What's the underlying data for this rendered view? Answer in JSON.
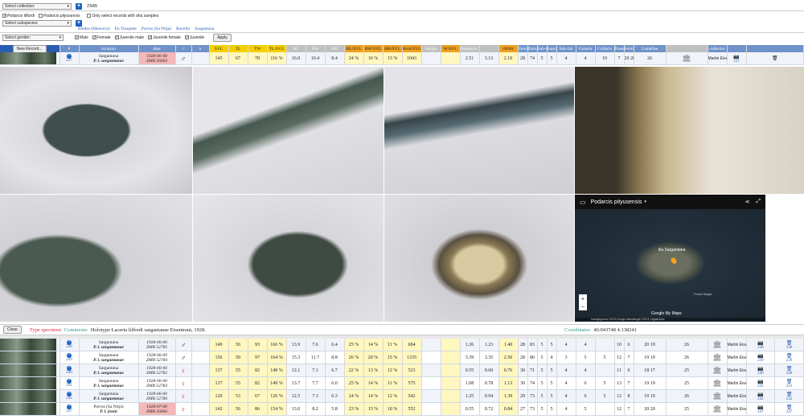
{
  "filters": {
    "collection_placeholder": "Select collection:",
    "collection_code": "ZMB",
    "species": [
      {
        "label": "Podarcis lilfordi",
        "checked": true
      },
      {
        "label": "Podarcis pityusensis",
        "checked": false
      }
    ],
    "dna_label": "Only select records with dna samples",
    "subspecies_placeholder": "Select subspecies:",
    "localities": [
      "Bledes (Menorca)",
      "En Tosqueta",
      "Porros (Sa Nitja)",
      "Ravello",
      "Sargantana"
    ],
    "gender_placeholder": "Select gender:",
    "genders": [
      {
        "label": "Male",
        "checked": true
      },
      {
        "label": "Female",
        "checked": true
      },
      {
        "label": "Juvenile male",
        "checked": true
      },
      {
        "label": "Juvenile female",
        "checked": true
      },
      {
        "label": "Juvenile",
        "checked": true
      }
    ],
    "apply_label": "Apply"
  },
  "table": {
    "new_record_label": "New Record...",
    "headers": [
      "location",
      "date",
      "♂",
      "n",
      "SVL",
      "TL",
      "TW",
      "TL/SVL",
      "HL",
      "HW",
      "HH",
      "HL/SVL",
      "HW/SVL",
      "HH/SVL",
      "Hvol/SVL",
      "Weight",
      "W/SVL",
      "Massetric",
      "",
      "rMAS",
      "Ventralia",
      "Dorsalia",
      "Sub-mac",
      "Supra-lab",
      "Sub-lab",
      "Gularia",
      "Collaria",
      "Praeanalia",
      "Femoralia",
      "Lamellae",
      "",
      "collector"
    ]
  },
  "selected": {
    "id": "237",
    "loc1": "Sargantana",
    "loc2": "P. l. sargantanae",
    "date": "1928-06-00",
    "num": "ZMB 56063",
    "sex": "♂",
    "n": "",
    "svl": "145",
    "tl": "67",
    "tw": "78",
    "tlsvl": "116 %",
    "hl": "16.0",
    "hw": "10.4",
    "hh": "8.4",
    "hlsvl": "24 %",
    "hwsvl": "16 %",
    "hhsvl": "13 %",
    "hvol": "1043",
    "mas1": "2.51",
    "mas2": "3.13",
    "rmas": "2.10",
    "ventr": "28",
    "dors": "74",
    "submac": "5",
    "supra": "5",
    "sublab": "4",
    "gul": "4",
    "coll": "10",
    "prae": "7",
    "fem1": "20",
    "fem2": "20",
    "lam": "26",
    "collector": "Martin Eisentraut",
    "copy": "237"
  },
  "map": {
    "title": "Podarcis pityusensis",
    "place": "illa Sargantana",
    "attribution": "Kaartgegevens ©2019 Google Afbeeldingen ©2019, DigitalGlobe",
    "google": "Google My Maps",
    "label2": "Punta Negra"
  },
  "detail": {
    "close_label": "Close",
    "type_label": "Type specimen",
    "comments_label": "Comments:",
    "comments": "Holotype Lacerta lilfordi sargantanae Eisentraut, 1928.",
    "coords_label": "Coordinates:",
    "coords": "40.043748 4.138241"
  },
  "rows": [
    {
      "id": "238",
      "loc1": "Sargantana",
      "loc2": "P. l. sargantanae",
      "date": "1928-06-00",
      "num": "ZMB 52785",
      "sex": "♂",
      "svl": "149",
      "tl": "56",
      "tw": "93",
      "tlsvl": "166 %",
      "hl": "13.9",
      "hw": "7.6",
      "hh": "6.4",
      "hlsvl": "25 %",
      "hwsvl": "14 %",
      "hhsvl": "11 %",
      "hvol": "604",
      "mas1": "1.26",
      "mas2": "1.23",
      "rmas": "1.40",
      "ventr": "28",
      "dors": "83",
      "submac": "5",
      "supra": "5",
      "sublab": "4",
      "gul": "4",
      "gul2": "",
      "coll": "10",
      "prae": "6",
      "fem1": "20",
      "fem2": "19",
      "lam": "26",
      "collector": "Martin Eisentraut",
      "red": false
    },
    {
      "id": "239",
      "loc1": "Sargantana",
      "loc2": "P. l. sargantanae",
      "date": "1928-06-00",
      "num": "ZMB 52784",
      "sex": "♂",
      "svl": "156",
      "tl": "59",
      "tw": "97",
      "tlsvl": "164 %",
      "hl": "15.3",
      "hw": "11.7",
      "hh": "8.8",
      "hlsvl": "26 %",
      "hwsvl": "20 %",
      "hhsvl": "15 %",
      "hvol": "1335",
      "mas1": "3.39",
      "mas2": "3.35",
      "rmas": "2.50",
      "ventr": "28",
      "dors": "80",
      "submac": "5",
      "supra": "4",
      "sublab": "3",
      "gul": "5",
      "gul2": "5",
      "coll": "12",
      "prae": "7",
      "fem1": "19",
      "fem2": "19",
      "lam": "26",
      "collector": "Martin Eisentraut",
      "red": false
    },
    {
      "id": "240",
      "loc1": "Sargantana",
      "loc2": "P. l. sargantanae",
      "date": "1928-06-00",
      "num": "ZMB 52782",
      "sex": "♀",
      "svl": "137",
      "tl": "55",
      "tw": "82",
      "tlsvl": "149 %",
      "hl": "12.1",
      "hw": "7.1",
      "hh": "6.7",
      "hlsvl": "22 %",
      "hwsvl": "13 %",
      "hhsvl": "12 %",
      "hvol": "523",
      "mas1": "0.55",
      "mas2": "0.69",
      "rmas": "0.76",
      "ventr": "30",
      "dors": "71",
      "submac": "5",
      "supra": "5",
      "sublab": "4",
      "gul": "4",
      "gul2": "",
      "coll": "11",
      "prae": "6",
      "fem1": "18",
      "fem2": "17",
      "lam": "25",
      "collector": "Martin Eisentraut",
      "red": false
    },
    {
      "id": "241",
      "loc1": "Sargantana",
      "loc2": "P. l. sargantanae",
      "date": "1928-06-00",
      "num": "ZMB 52783",
      "sex": "♀",
      "svl": "137",
      "tl": "55",
      "tw": "82",
      "tlsvl": "149 %",
      "hl": "13.7",
      "hw": "7.7",
      "hh": "6.0",
      "hlsvl": "25 %",
      "hwsvl": "14 %",
      "hhsvl": "11 %",
      "hvol": "575",
      "mas1": "1.08",
      "mas2": "0.78",
      "rmas": "1.13",
      "ventr": "30",
      "dors": "74",
      "submac": "5",
      "supra": "5",
      "sublab": "4",
      "gul": "6",
      "gul2": "5",
      "coll": "13",
      "prae": "7",
      "fem1": "19",
      "fem2": "19",
      "lam": "25",
      "collector": "Martin Eisentraut",
      "red": false
    },
    {
      "id": "242",
      "loc1": "Sargantana",
      "loc2": "P. l. sargantanae",
      "date": "1928-06-00",
      "num": "ZMB 52786",
      "sex": "♀",
      "svl": "120",
      "tl": "53",
      "tw": "67",
      "tlsvl": "126 %",
      "hl": "12.5",
      "hw": "7.3",
      "hh": "6.3",
      "hlsvl": "24 %",
      "hwsvl": "14 %",
      "hhsvl": "12 %",
      "hvol": "542",
      "mas1": "1.25",
      "mas2": "0.94",
      "rmas": "1.39",
      "ventr": "29",
      "dors": "73",
      "submac": "5",
      "supra": "5",
      "sublab": "4",
      "gul": "6",
      "gul2": "5",
      "coll": "12",
      "prae": "8",
      "fem1": "19",
      "fem2": "19",
      "lam": "26",
      "collector": "Martin Eisentraut",
      "red": false
    },
    {
      "id": "247",
      "loc1": "Porros (Sa Nitja)",
      "loc2": "P. l. fenni",
      "date": "1928-07-00",
      "num": "ZMB 56066",
      "sex": "♀",
      "svl": "142",
      "tl": "56",
      "tw": "86",
      "tlsvl": "154 %",
      "hl": "13.0",
      "hw": "8.2",
      "hh": "5.8",
      "hlsvl": "23 %",
      "hwsvl": "15 %",
      "hhsvl": "10 %",
      "hvol": "552",
      "mas1": "0.55",
      "mas2": "0.72",
      "rmas": "0.84",
      "ventr": "27",
      "dors": "73",
      "submac": "5",
      "supra": "5",
      "sublab": "4",
      "gul": "5",
      "gul2": "",
      "coll": "12",
      "prae": "7",
      "fem1": "20",
      "fem2": "20",
      "lam": "25",
      "collector": "Martin Eisentraut",
      "red": true
    }
  ]
}
